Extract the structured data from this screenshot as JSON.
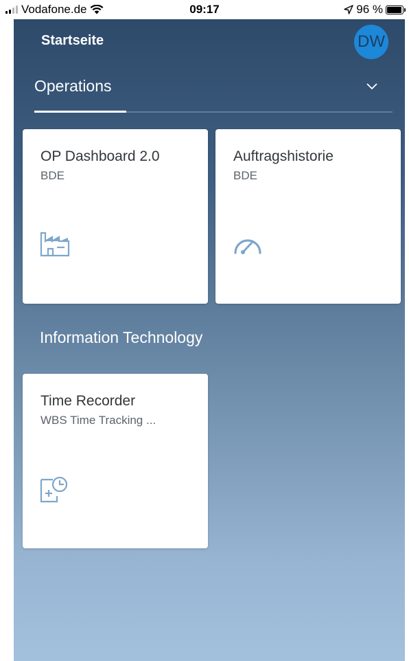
{
  "status_bar": {
    "carrier": "Vodafone.de",
    "time": "09:17",
    "battery_percent": "96 %",
    "battery_level": 0.96,
    "signal_bars": 2,
    "wifi": "wifi-icon",
    "location": "location-arrow-icon"
  },
  "header": {
    "title": "Startseite",
    "avatar_initials": "DW",
    "avatar_color": "#1e88d8"
  },
  "tabs": {
    "active_label": "Operations",
    "chevron": "chevron-down-icon"
  },
  "groups": [
    {
      "title": "Operations",
      "tiles": [
        {
          "title": "OP Dashboard 2.0",
          "subtitle": "BDE",
          "icon": "factory-icon"
        },
        {
          "title": "Auftragshistorie",
          "subtitle": "BDE",
          "icon": "speedometer-icon"
        }
      ]
    },
    {
      "title": "Information Technology",
      "tiles": [
        {
          "title": "Time Recorder",
          "subtitle": "WBS Time Tracking ...",
          "icon": "timesheet-clock-icon"
        }
      ]
    }
  ],
  "colors": {
    "icon_blue": "#7da6cc",
    "tile_title": "#32363a",
    "tile_subtitle": "#5c636b"
  }
}
